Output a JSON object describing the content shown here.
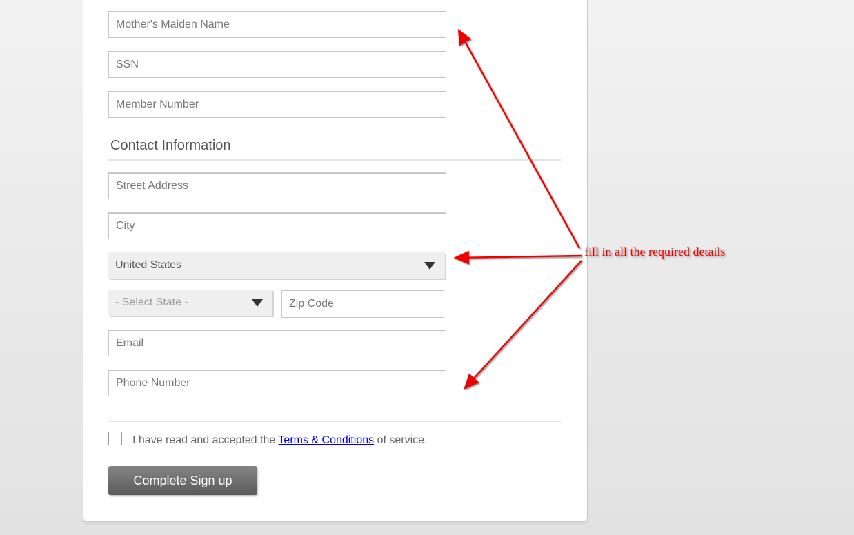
{
  "form": {
    "fields": {
      "mothers_maiden_name": {
        "placeholder": "Mother's Maiden Name",
        "value": ""
      },
      "ssn": {
        "placeholder": "SSN",
        "value": ""
      },
      "member_number": {
        "placeholder": "Member Number",
        "value": ""
      },
      "street_address": {
        "placeholder": "Street Address",
        "value": ""
      },
      "city": {
        "placeholder": "City",
        "value": ""
      },
      "zip_code": {
        "placeholder": "Zip Code",
        "value": ""
      },
      "email": {
        "placeholder": "Email",
        "value": ""
      },
      "phone_number": {
        "placeholder": "Phone Number",
        "value": ""
      }
    },
    "contact_section_title": "Contact Information",
    "country_select": {
      "selected": "United States"
    },
    "state_select": {
      "selected": "- Select State -"
    },
    "terms": {
      "prefix": "I have read and accepted the ",
      "link_text": "Terms & Conditions",
      "suffix": " of service.",
      "checked": false
    },
    "submit_label": "Complete Sign up"
  },
  "annotation": {
    "text": "fill in all the required details",
    "color": "#ee0000"
  }
}
